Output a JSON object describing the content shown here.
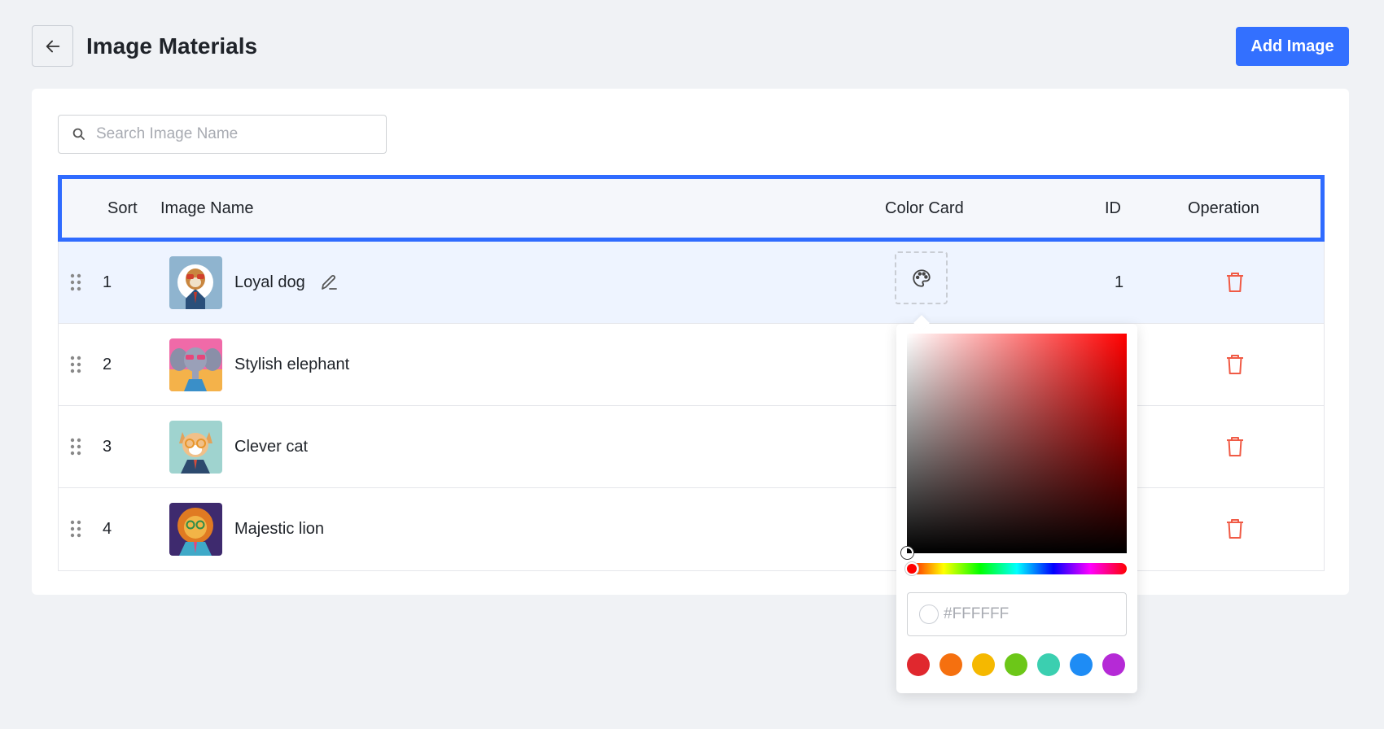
{
  "header": {
    "title": "Image Materials",
    "add_button": "Add Image"
  },
  "search": {
    "placeholder": "Search Image Name"
  },
  "table": {
    "columns": {
      "sort": "Sort",
      "name": "Image Name",
      "color": "Color Card",
      "id": "ID",
      "operation": "Operation"
    },
    "rows": [
      {
        "sort": "1",
        "name": "Loyal dog",
        "id": "1"
      },
      {
        "sort": "2",
        "name": "Stylish elephant",
        "id": ""
      },
      {
        "sort": "3",
        "name": "Clever cat",
        "id": ""
      },
      {
        "sort": "4",
        "name": "Majestic lion",
        "id": ""
      }
    ]
  },
  "color_picker": {
    "hue": "#FF0000",
    "hex_placeholder": "#FFFFFF",
    "presets": [
      "#e0282e",
      "#f5700f",
      "#f5b800",
      "#6cc718",
      "#3bcfb0",
      "#1e8cf5",
      "#b52ad6"
    ]
  },
  "colors": {
    "accent": "#3370ff",
    "delete": "#f05a45"
  }
}
